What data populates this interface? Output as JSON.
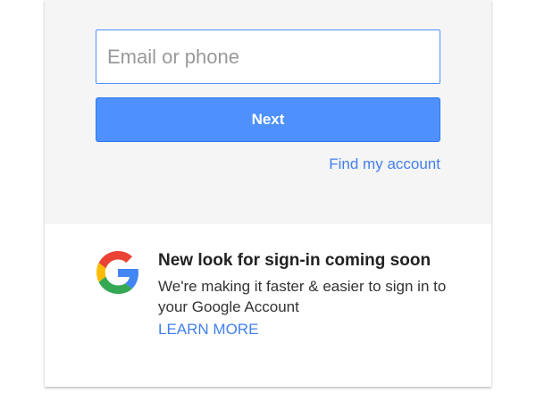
{
  "signin": {
    "email_placeholder": "Email or phone",
    "email_value": "",
    "next_label": "Next",
    "find_account_label": "Find my account"
  },
  "promo": {
    "logo_icon": "google-g-logo-icon",
    "title": "New look for sign-in coming soon",
    "body": "We're making it faster & easier to sign in to your Google Account",
    "learn_more_label": "LEARN MORE"
  },
  "colors": {
    "accent_blue": "#4d90fe",
    "link_blue": "#427fed",
    "panel_gray": "#f5f5f5",
    "logo_blue": "#4285f4",
    "logo_red": "#ea4335",
    "logo_yellow": "#fbbc05",
    "logo_green": "#34a853"
  }
}
